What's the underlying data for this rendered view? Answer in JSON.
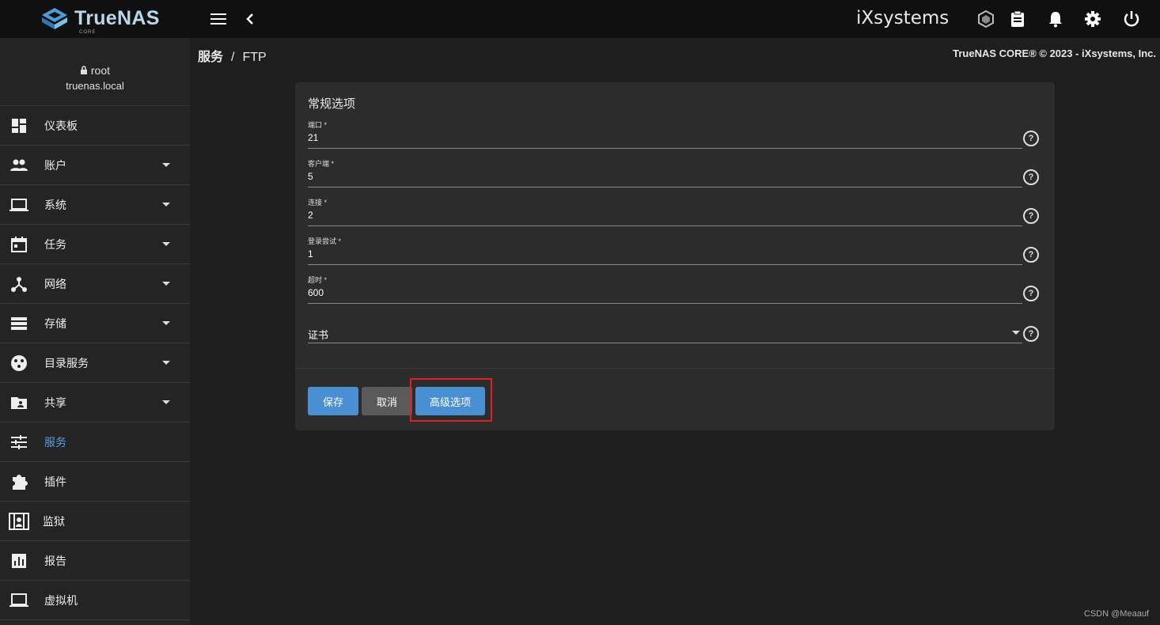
{
  "app": {
    "brand": "TrueNAS",
    "brand_sub": "CORE",
    "vendor": "iXsystems"
  },
  "user": {
    "name": "root",
    "host": "truenas.local"
  },
  "sidebar": {
    "items": [
      {
        "label": "仪表板",
        "icon": "dashboard-icon",
        "expandable": false
      },
      {
        "label": "账户",
        "icon": "people-icon",
        "expandable": true
      },
      {
        "label": "系统",
        "icon": "laptop-icon",
        "expandable": true
      },
      {
        "label": "任务",
        "icon": "calendar-icon",
        "expandable": true
      },
      {
        "label": "网络",
        "icon": "network-icon",
        "expandable": true
      },
      {
        "label": "存储",
        "icon": "storage-icon",
        "expandable": true
      },
      {
        "label": "目录服务",
        "icon": "directory-icon",
        "expandable": true
      },
      {
        "label": "共享",
        "icon": "share-folder-icon",
        "expandable": true
      },
      {
        "label": "服务",
        "icon": "tune-icon",
        "expandable": false,
        "active": true
      },
      {
        "label": "插件",
        "icon": "puzzle-icon",
        "expandable": false
      },
      {
        "label": "监狱",
        "icon": "jail-icon",
        "expandable": false
      },
      {
        "label": "报告",
        "icon": "chart-icon",
        "expandable": false
      },
      {
        "label": "虚拟机",
        "icon": "monitor-icon",
        "expandable": false
      }
    ]
  },
  "breadcrumb": {
    "parent": "服务",
    "separator": "/",
    "current": "FTP"
  },
  "copyright": "TrueNAS CORE® © 2023 - iXsystems, Inc.",
  "form": {
    "title": "常规选项",
    "fields": [
      {
        "label": "端口 *",
        "value": "21"
      },
      {
        "label": "客户端 *",
        "value": "5"
      },
      {
        "label": "连接 *",
        "value": "2"
      },
      {
        "label": "登录尝试 *",
        "value": "1"
      },
      {
        "label": "超时 *",
        "value": "600"
      }
    ],
    "certificate": {
      "label": "证书",
      "value": ""
    },
    "buttons": {
      "save": "保存",
      "cancel": "取消",
      "advanced": "高级选项"
    }
  },
  "colors": {
    "accent": "#4a8fd4",
    "active_nav": "#5a9ddb",
    "highlight": "#e02020"
  },
  "watermark": "CSDN @Meaauf"
}
